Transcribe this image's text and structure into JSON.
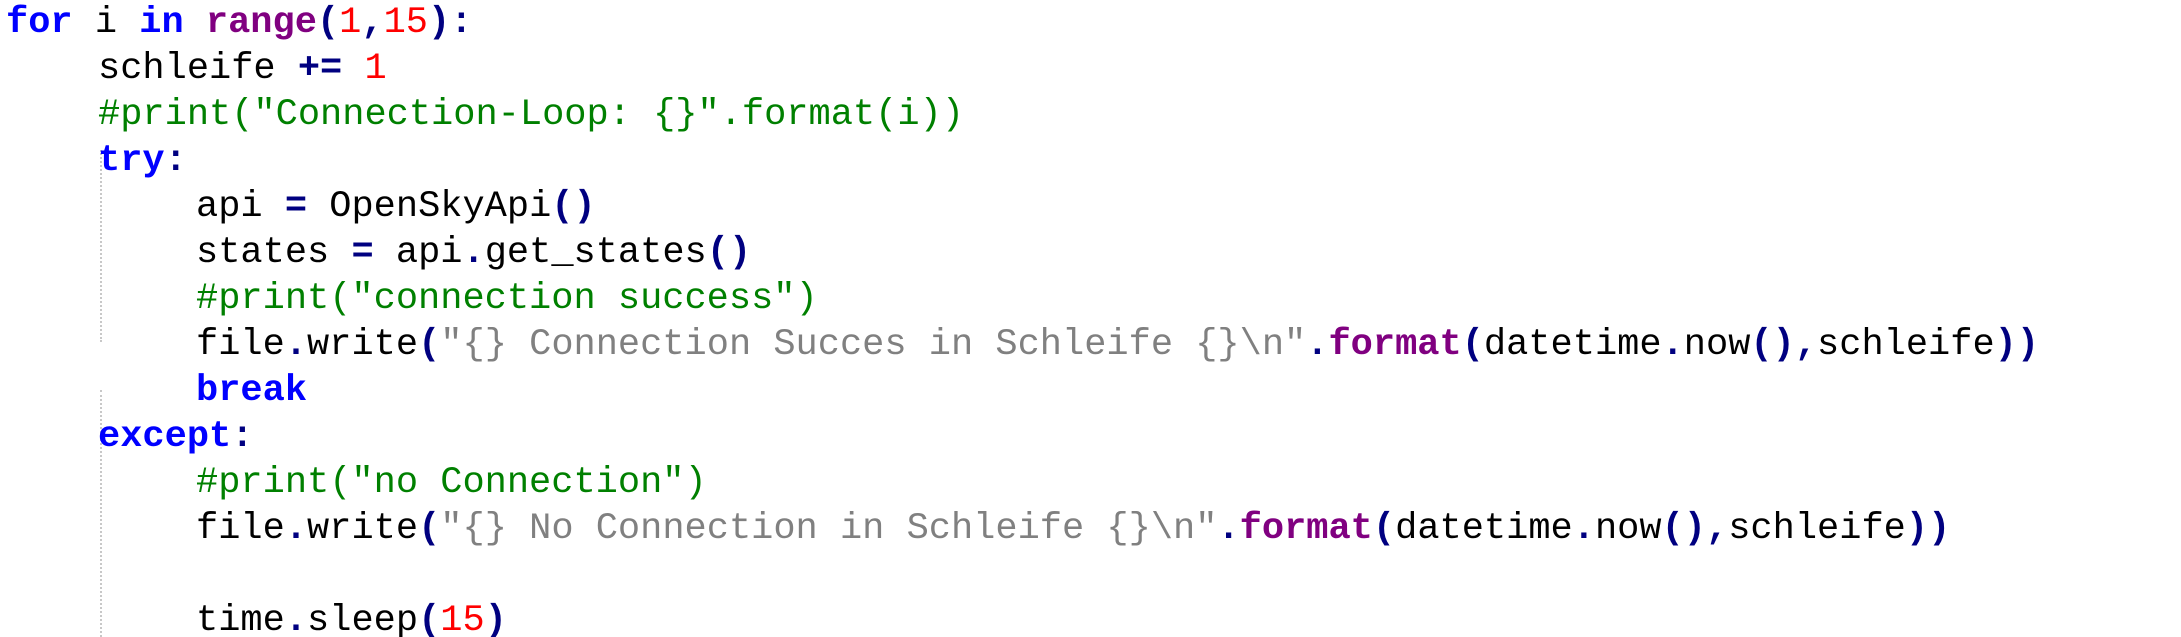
{
  "code": {
    "lines": [
      {
        "segments": [
          {
            "text": "for",
            "kind": "kw"
          },
          {
            "text": " i ",
            "kind": "txt"
          },
          {
            "text": "in",
            "kind": "kw"
          },
          {
            "text": " ",
            "kind": "txt"
          },
          {
            "text": "range",
            "kind": "fn"
          },
          {
            "text": "(",
            "kind": "op"
          },
          {
            "text": "1",
            "kind": "num"
          },
          {
            "text": ",",
            "kind": "op"
          },
          {
            "text": "15",
            "kind": "num"
          },
          {
            "text": "):",
            "kind": "op"
          }
        ]
      },
      {
        "segments": [
          {
            "text": "schleife ",
            "kind": "txt"
          },
          {
            "text": "+=",
            "kind": "op"
          },
          {
            "text": " ",
            "kind": "txt"
          },
          {
            "text": "1",
            "kind": "num"
          }
        ]
      },
      {
        "segments": [
          {
            "text": "#print(\"Connection-Loop: {}\".format(i))",
            "kind": "cmt"
          }
        ]
      },
      {
        "segments": [
          {
            "text": "try",
            "kind": "kw"
          },
          {
            "text": ":",
            "kind": "op"
          }
        ]
      },
      {
        "segments": [
          {
            "text": "api ",
            "kind": "txt"
          },
          {
            "text": "=",
            "kind": "op"
          },
          {
            "text": " OpenSkyApi",
            "kind": "txt"
          },
          {
            "text": "()",
            "kind": "op"
          }
        ]
      },
      {
        "segments": [
          {
            "text": "states ",
            "kind": "txt"
          },
          {
            "text": "=",
            "kind": "op"
          },
          {
            "text": " api",
            "kind": "txt"
          },
          {
            "text": ".",
            "kind": "op"
          },
          {
            "text": "get_states",
            "kind": "txt"
          },
          {
            "text": "()",
            "kind": "op"
          }
        ]
      },
      {
        "segments": [
          {
            "text": "#print(\"connection success\")",
            "kind": "cmt"
          }
        ]
      },
      {
        "segments": [
          {
            "text": "file",
            "kind": "txt"
          },
          {
            "text": ".",
            "kind": "op"
          },
          {
            "text": "write",
            "kind": "txt"
          },
          {
            "text": "(",
            "kind": "op"
          },
          {
            "text": "\"{} Connection Succes in Schleife {}\\n\"",
            "kind": "str"
          },
          {
            "text": ".",
            "kind": "op"
          },
          {
            "text": "format",
            "kind": "fn"
          },
          {
            "text": "(",
            "kind": "op"
          },
          {
            "text": "datetime",
            "kind": "txt"
          },
          {
            "text": ".",
            "kind": "op"
          },
          {
            "text": "now",
            "kind": "txt"
          },
          {
            "text": "(),",
            "kind": "op"
          },
          {
            "text": "schleife",
            "kind": "txt"
          },
          {
            "text": "))",
            "kind": "op"
          }
        ]
      },
      {
        "segments": [
          {
            "text": "break",
            "kind": "kw"
          }
        ]
      },
      {
        "segments": [
          {
            "text": "except",
            "kind": "kw"
          },
          {
            "text": ":",
            "kind": "op"
          }
        ]
      },
      {
        "segments": [
          {
            "text": "#print(\"no Connection\")",
            "kind": "cmt"
          }
        ]
      },
      {
        "segments": [
          {
            "text": "file",
            "kind": "txt"
          },
          {
            "text": ".",
            "kind": "op"
          },
          {
            "text": "write",
            "kind": "txt"
          },
          {
            "text": "(",
            "kind": "op"
          },
          {
            "text": "\"{} No Connection in Schleife {}\\n\"",
            "kind": "str"
          },
          {
            "text": ".",
            "kind": "op"
          },
          {
            "text": "format",
            "kind": "fn"
          },
          {
            "text": "(",
            "kind": "op"
          },
          {
            "text": "datetime",
            "kind": "txt"
          },
          {
            "text": ".",
            "kind": "op"
          },
          {
            "text": "now",
            "kind": "txt"
          },
          {
            "text": "(),",
            "kind": "op"
          },
          {
            "text": "schleife",
            "kind": "txt"
          },
          {
            "text": "))",
            "kind": "op"
          }
        ]
      },
      {
        "segments": []
      },
      {
        "segments": [
          {
            "text": "time",
            "kind": "txt"
          },
          {
            "text": ".",
            "kind": "op"
          },
          {
            "text": "sleep",
            "kind": "txt"
          },
          {
            "text": "(",
            "kind": "op"
          },
          {
            "text": "15",
            "kind": "num"
          },
          {
            "text": ")",
            "kind": "op"
          }
        ]
      }
    ]
  },
  "colors": {
    "keyword": "#0000ff",
    "builtin": "#800080",
    "number": "#ff0000",
    "operator": "#000080",
    "comment": "#008000",
    "string": "#808080",
    "text": "#000000",
    "background": "#ffffff"
  }
}
